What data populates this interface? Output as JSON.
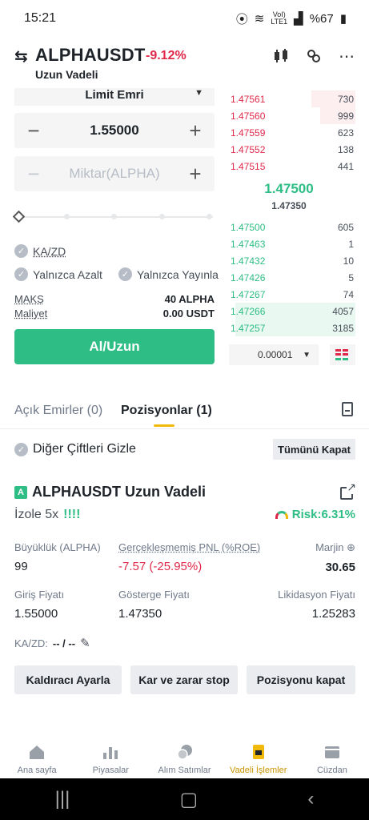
{
  "status_bar": {
    "time": "15:21",
    "volte_top": "VoI)",
    "volte_bottom": "LTE1",
    "battery": "%67"
  },
  "header": {
    "pair": "ALPHAUSDT",
    "change_pct": "-9.12%",
    "subtitle": "Uzun Vadeli"
  },
  "order_form": {
    "order_type": "Limit Emri",
    "price": "1.55000",
    "amount_placeholder": "Miktar(ALPHA)",
    "tp_sl_label": "KA/ZD",
    "reduce_only_label": "Yalnızca Azalt",
    "post_only_label": "Yalnızca Yayınla",
    "max_label": "MAKS",
    "max_value": "40 ALPHA",
    "cost_label": "Maliyet",
    "cost_value": "0.00 USDT",
    "buy_button": "Al/Uzun",
    "slider_level": 0
  },
  "order_book": {
    "asks": [
      {
        "price": "1.47561",
        "qty": "730",
        "depth": 0.35
      },
      {
        "price": "1.47560",
        "qty": "999",
        "depth": 0.28
      },
      {
        "price": "1.47559",
        "qty": "623",
        "depth": 0.0
      },
      {
        "price": "1.47552",
        "qty": "138",
        "depth": 0.0
      },
      {
        "price": "1.47515",
        "qty": "441",
        "depth": 0.0
      }
    ],
    "last_price": "1.47500",
    "mark_price": "1.47350",
    "bids": [
      {
        "price": "1.47500",
        "qty": "605",
        "depth": 0.0
      },
      {
        "price": "1.47463",
        "qty": "1",
        "depth": 0.0
      },
      {
        "price": "1.47432",
        "qty": "10",
        "depth": 0.0
      },
      {
        "price": "1.47426",
        "qty": "5",
        "depth": 0.0
      },
      {
        "price": "1.47267",
        "qty": "74",
        "depth": 0.0
      },
      {
        "price": "1.47266",
        "qty": "4057",
        "depth": 0.95
      },
      {
        "price": "1.47257",
        "qty": "3185",
        "depth": 0.95
      }
    ],
    "precision": "0.00001"
  },
  "tabs": {
    "open_orders": "Açık Emirler (0)",
    "positions": "Pozisyonlar (1)"
  },
  "positions": {
    "hide_other_pairs": "Diğer Çiftleri Gizle",
    "close_all": "Tümünü Kapat",
    "badge": "A",
    "title": "ALPHAUSDT Uzun Vadeli",
    "margin_mode": "İzole 5x",
    "leverage_bars": "!!!!",
    "risk": "Risk:6.31%",
    "size_label": "Büyüklük (ALPHA)",
    "size_value": "99",
    "pnl_label": "Gerçekleşmemiş PNL (%ROE)",
    "pnl_value": "-7.57 (-25.95%)",
    "margin_label": "Marjin ⊕",
    "margin_value": "30.65",
    "entry_label": "Giriş Fiyatı",
    "entry_value": "1.55000",
    "mark_label": "Gösterge Fiyatı",
    "mark_value": "1.47350",
    "liq_label": "Likidasyon Fiyatı",
    "liq_value": "1.25283",
    "tpsl_label": "KA/ZD:",
    "tpsl_value": "-- / --",
    "adjust_leverage": "Kaldıracı Ayarla",
    "tp_sl_button": "Kar ve zarar stop",
    "close_position": "Pozisyonu kapat"
  },
  "bottom_nav": [
    {
      "label": "Ana sayfa",
      "icon": "home-icon"
    },
    {
      "label": "Piyasalar",
      "icon": "markets-icon"
    },
    {
      "label": "Alım Satımlar",
      "icon": "trade-icon"
    },
    {
      "label": "Vadeli İşlemler",
      "icon": "futures-icon"
    },
    {
      "label": "Cüzdan",
      "icon": "wallet-icon"
    }
  ],
  "colors": {
    "green": "#2ebd85",
    "red": "#e0294a",
    "accent": "#f0b90b"
  }
}
